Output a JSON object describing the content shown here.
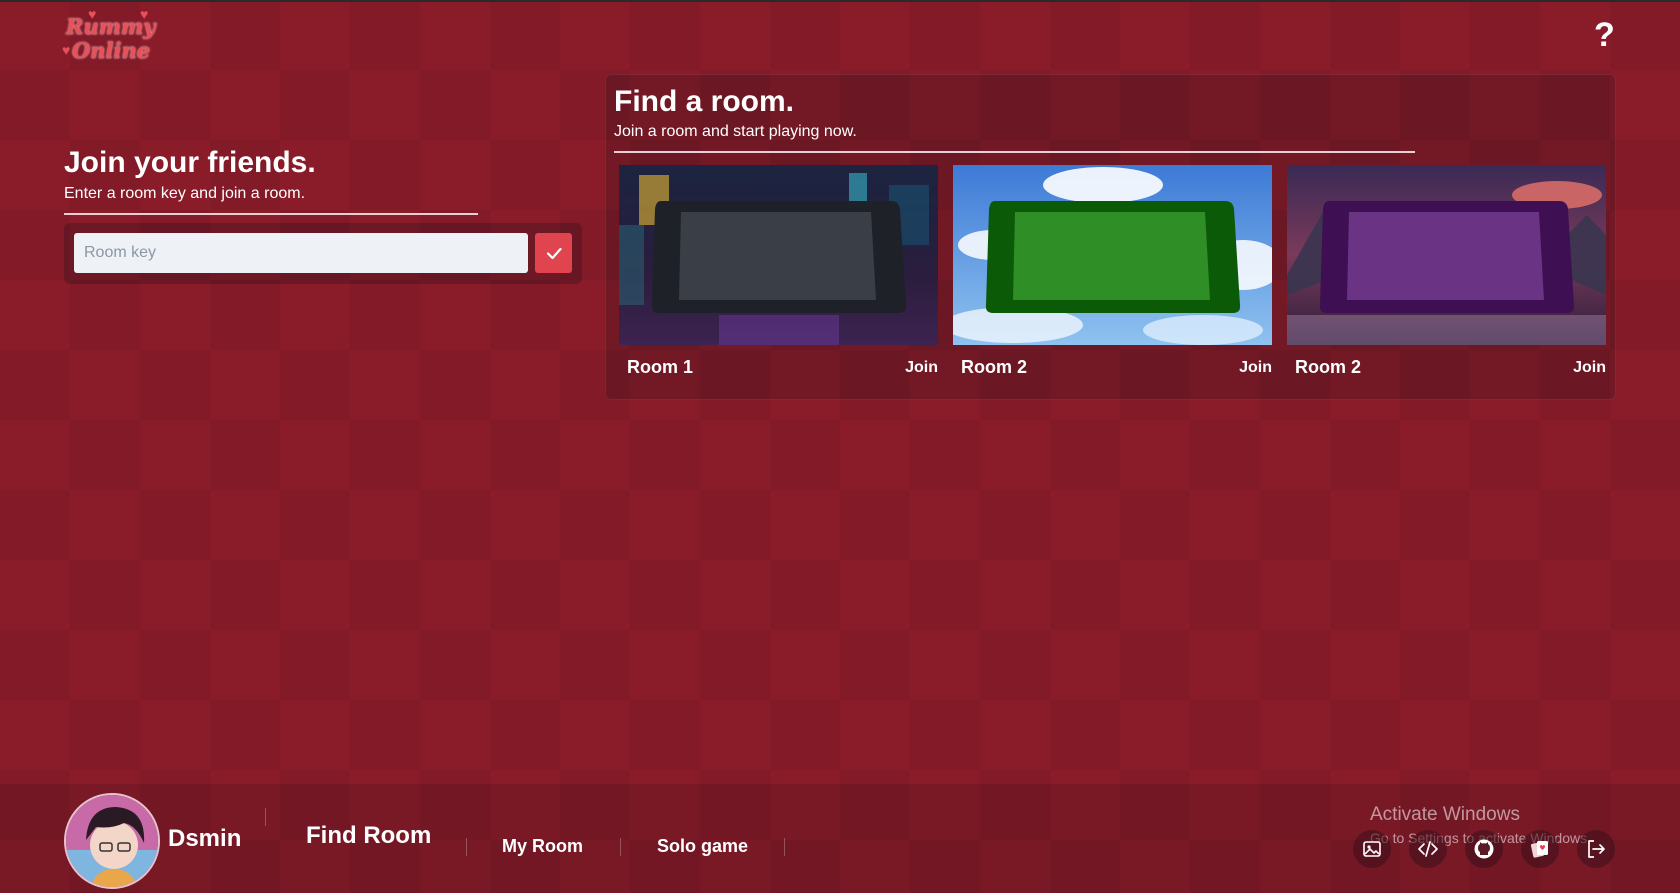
{
  "logo": {
    "line1": "Rummy",
    "line2": "Online"
  },
  "help": {
    "label": "?"
  },
  "join": {
    "title": "Join your friends.",
    "subtitle": "Enter a room key and join a room.",
    "input_placeholder": "Room key",
    "input_value": ""
  },
  "find": {
    "title": "Find a room.",
    "subtitle": "Join a room and start playing now.",
    "rooms": [
      {
        "name": "Room 1",
        "join_label": "Join",
        "table_color": "#3a3f47",
        "theme": "neon city"
      },
      {
        "name": "Room 2",
        "join_label": "Join",
        "table_color": "#1f8a16",
        "theme": "sky clouds"
      },
      {
        "name": "Room 2",
        "join_label": "Join",
        "table_color": "#6a1a82",
        "theme": "mountain sunset"
      }
    ]
  },
  "user": {
    "name": "Dsmin"
  },
  "nav": {
    "find_room": "Find Room",
    "my_room": "My Room",
    "solo_game": "Solo game"
  },
  "watermark": {
    "line1": "Activate Windows",
    "line2": "Go to Settings to activate Windows."
  },
  "toolbar_icons": [
    "image-icon",
    "code-icon",
    "github-icon",
    "cards-icon",
    "logout-icon"
  ],
  "colors": {
    "background": "#8a1c2a",
    "accent": "#e0454f"
  }
}
